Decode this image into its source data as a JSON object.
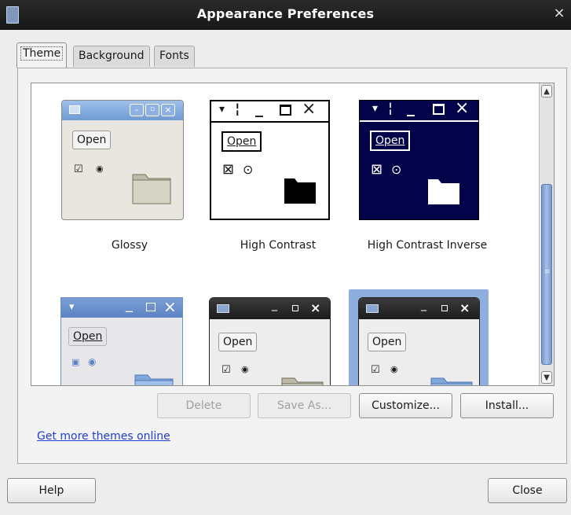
{
  "window": {
    "title": "Appearance Preferences",
    "close_glyph": "×",
    "icon": "app-icon"
  },
  "tabs": [
    {
      "label": "Theme",
      "active": true
    },
    {
      "label": "Background",
      "active": false
    },
    {
      "label": "Fonts",
      "active": false
    }
  ],
  "themes": [
    {
      "name": "Glossy",
      "open_label": "Open",
      "selected": false
    },
    {
      "name": "High Contrast",
      "open_label": "Open",
      "selected": false
    },
    {
      "name": "High Contrast Inverse",
      "open_label": "Open",
      "selected": false
    },
    {
      "name": "",
      "open_label": "Open",
      "selected": false
    },
    {
      "name": "",
      "open_label": "Open",
      "selected": false
    },
    {
      "name": "",
      "open_label": "Open",
      "selected": true
    }
  ],
  "actions": {
    "delete_label": "Delete",
    "save_as_label": "Save As...",
    "customize_label": "Customize...",
    "install_label": "Install..."
  },
  "more_themes_link": "Get more themes online",
  "footer": {
    "help_label": "Help",
    "close_label": "Close"
  },
  "colors": {
    "selection": "#8faede",
    "link": "#1f3dd6",
    "scroll_thumb": "#7396cf",
    "inverse_bg": "#03034a"
  }
}
